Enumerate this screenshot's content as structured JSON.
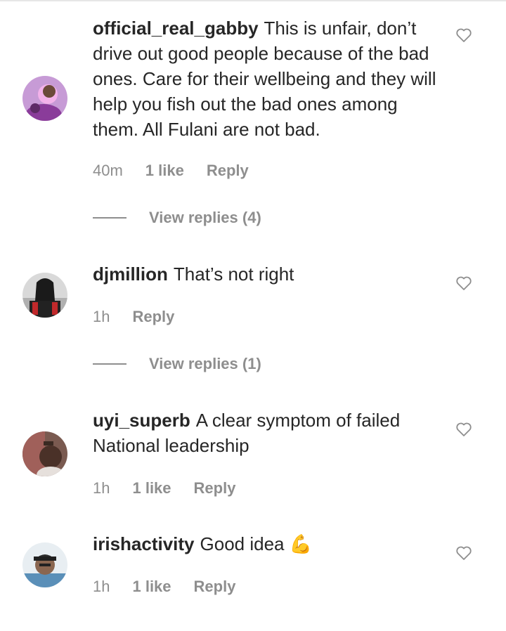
{
  "comments": [
    {
      "username": "official_real_gabby",
      "text": "This is unfair, don’t drive out good people because of the bad ones. Care for their wellbeing and they will help you fish out the bad ones among them. All Fulani are not bad.",
      "time": "40m",
      "likes": "1 like",
      "reply": "Reply",
      "view_replies": "View replies (4)"
    },
    {
      "username": "djmillion",
      "text": "That’s not right",
      "time": "1h",
      "reply": "Reply",
      "view_replies": "View replies (1)"
    },
    {
      "username": "uyi_superb",
      "text": "A clear symptom of failed National leadership",
      "time": "1h",
      "likes": "1 like",
      "reply": "Reply"
    },
    {
      "username": "irishactivity",
      "text": "Good idea",
      "emoji": "💪",
      "time": "1h",
      "likes": "1 like",
      "reply": "Reply"
    }
  ],
  "icons": {
    "like": "heart-outline-icon"
  },
  "colors": {
    "text": "#262626",
    "meta": "#8e8e8e"
  }
}
